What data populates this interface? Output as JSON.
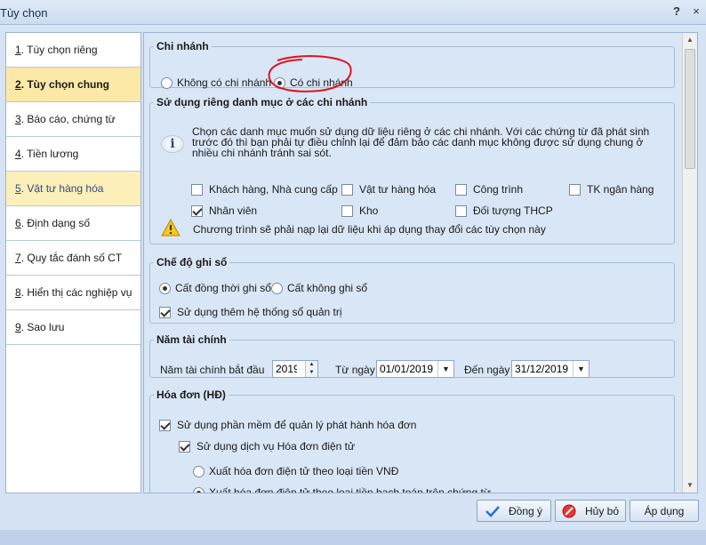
{
  "window": {
    "title": "Tùy chọn",
    "help_label": "?",
    "close_label": "×"
  },
  "nav": {
    "items": [
      {
        "mnemonic": "1",
        "label": ". Tùy chọn riêng"
      },
      {
        "mnemonic": "2",
        "label": ". Tùy chọn chung"
      },
      {
        "mnemonic": "3",
        "label": ". Báo cáo, chứng từ"
      },
      {
        "mnemonic": "4",
        "label": ". Tiền lương"
      },
      {
        "mnemonic": "5",
        "label": ". Vật tư hàng hóa"
      },
      {
        "mnemonic": "6",
        "label": ". Định dạng số"
      },
      {
        "mnemonic": "7",
        "label": ". Quy tắc đánh số CT"
      },
      {
        "mnemonic": "8",
        "label": ". Hiển thị các nghiệp vụ"
      },
      {
        "mnemonic": "9",
        "label": ". Sao lưu"
      }
    ],
    "active_index": 1,
    "highlight_index": 4
  },
  "branch": {
    "title": "Chi nhánh",
    "no_branch": "Không có chi nhánh",
    "has_branch": "Có chi nhánh",
    "selected": "has_branch"
  },
  "catalog": {
    "title": "Sử dụng riêng danh mục ở các chi nhánh",
    "info": "Chọn các danh mục muốn sử dụng dữ liệu riêng ở các chi nhánh. Với các chứng từ đã phát sinh trước đó thì bạn phải tự điều chỉnh lại để đảm bảo các danh mục không được sử dụng chung ở nhiều chi nhánh tránh sai sót.",
    "items": {
      "customers": {
        "label": "Khách hàng, Nhà cung cấp",
        "checked": false
      },
      "materials": {
        "label": "Vật tư hàng hóa",
        "checked": false
      },
      "projects": {
        "label": "Công trình",
        "checked": false
      },
      "bank_accounts": {
        "label": "TK ngân hàng",
        "checked": false
      },
      "employees": {
        "label": "Nhân viên",
        "checked": true
      },
      "warehouse": {
        "label": "Kho",
        "checked": false
      },
      "cost_objects": {
        "label": "Đối tượng THCP",
        "checked": false
      }
    },
    "warning": "Chương trình sẽ phải nạp lại dữ liệu khi áp dụng thay đổi các tùy chọn này"
  },
  "ledger": {
    "title": "Chế độ ghi sổ",
    "record_both": "Cất đồng thời ghi sổ",
    "record_no": "Cất không ghi sổ",
    "selected": "record_both",
    "mgmt_book": {
      "label": "Sử dụng thêm hệ thống sổ quản trị",
      "checked": true
    }
  },
  "fiscal": {
    "title": "Năm tài chính",
    "start_label": "Năm tài chính bắt đầu",
    "year": "2019",
    "from_label": "Từ ngày",
    "from_date": "01/01/2019",
    "to_label": "Đến ngày",
    "to_date": "31/12/2019"
  },
  "invoice": {
    "title": "Hóa đơn (HĐ)",
    "use_software": {
      "label": "Sử dụng phần mềm để quản lý phát hành hóa đơn",
      "checked": true
    },
    "use_einvoice": {
      "label": "Sử dụng dịch vụ Hóa đơn điện tử",
      "checked": true
    },
    "issue_vnd": "Xuất hóa đơn điện tử theo loại tiền VNĐ",
    "issue_accounting": "Xuất hóa đơn điện tử theo loại tiền hạch toán trên chứng từ",
    "selected": "issue_accounting"
  },
  "buttons": {
    "ok": "Đồng ý",
    "cancel": "Hủy bỏ",
    "apply": "Áp dụng"
  },
  "colors": {
    "active_nav": "#fde9a7",
    "panel_bg": "#d9e6f6",
    "annotation": "#e0131c"
  }
}
